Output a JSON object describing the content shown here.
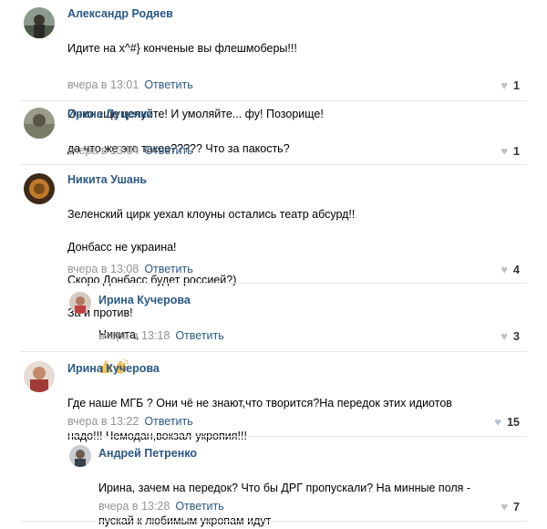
{
  "comments": [
    {
      "author": "Александр Родяев",
      "lines": [
        "Идите на х^#} конченые вы флешмоберы!!!",
        "",
        "Очко еще целуйте! И умоляйте... фу! Позорище!"
      ],
      "time": "вчера в 13:01",
      "reply": "Ответить",
      "likes": "1"
    },
    {
      "author": "Ирина Луценко",
      "lines": [
        "да что же это такое????? Что за пакость?"
      ],
      "time": "вчера в 13:04",
      "reply": "Ответить",
      "likes": "1"
    },
    {
      "author": "Никита Ушань",
      "lines": [
        "Зеленский цирк уехал клоуны остались театр абсурд!!",
        "Донбасс не украина!",
        "Скоро Донбасс будет россией?)",
        "За и против!"
      ],
      "time": "вчера в 13:08",
      "reply": "Ответить",
      "likes": "4"
    },
    {
      "author": "Ирина Кучерова",
      "lines": [
        "Никита,"
      ],
      "time": "вчера в 13:18",
      "reply": "Ответить",
      "likes": "3",
      "emoji": [
        "thumbs-up-emoji",
        "clapping-hands-emoji"
      ]
    },
    {
      "author": "Ирина Кучерова",
      "lines": [
        "Где наше МГБ ? Они чё не знают,что творится?На передок этих идиотов",
        "надо!!! Чемодан,вокзал-укропия!!!"
      ],
      "time": "вчера в 13:22",
      "reply": "Ответить",
      "likes": "15"
    },
    {
      "author": "Андрей Петренко",
      "lines": [
        "Ирина, зачем на передок? Что бы ДРГ пропускали? На минные поля -",
        "пускай к любимым укропам идут"
      ],
      "time": "вчера в 13:28",
      "reply": "Ответить",
      "likes": "7"
    }
  ],
  "colors": {
    "link": "#2a5885",
    "meta": "#939393",
    "divider": "#e7e8ec"
  }
}
